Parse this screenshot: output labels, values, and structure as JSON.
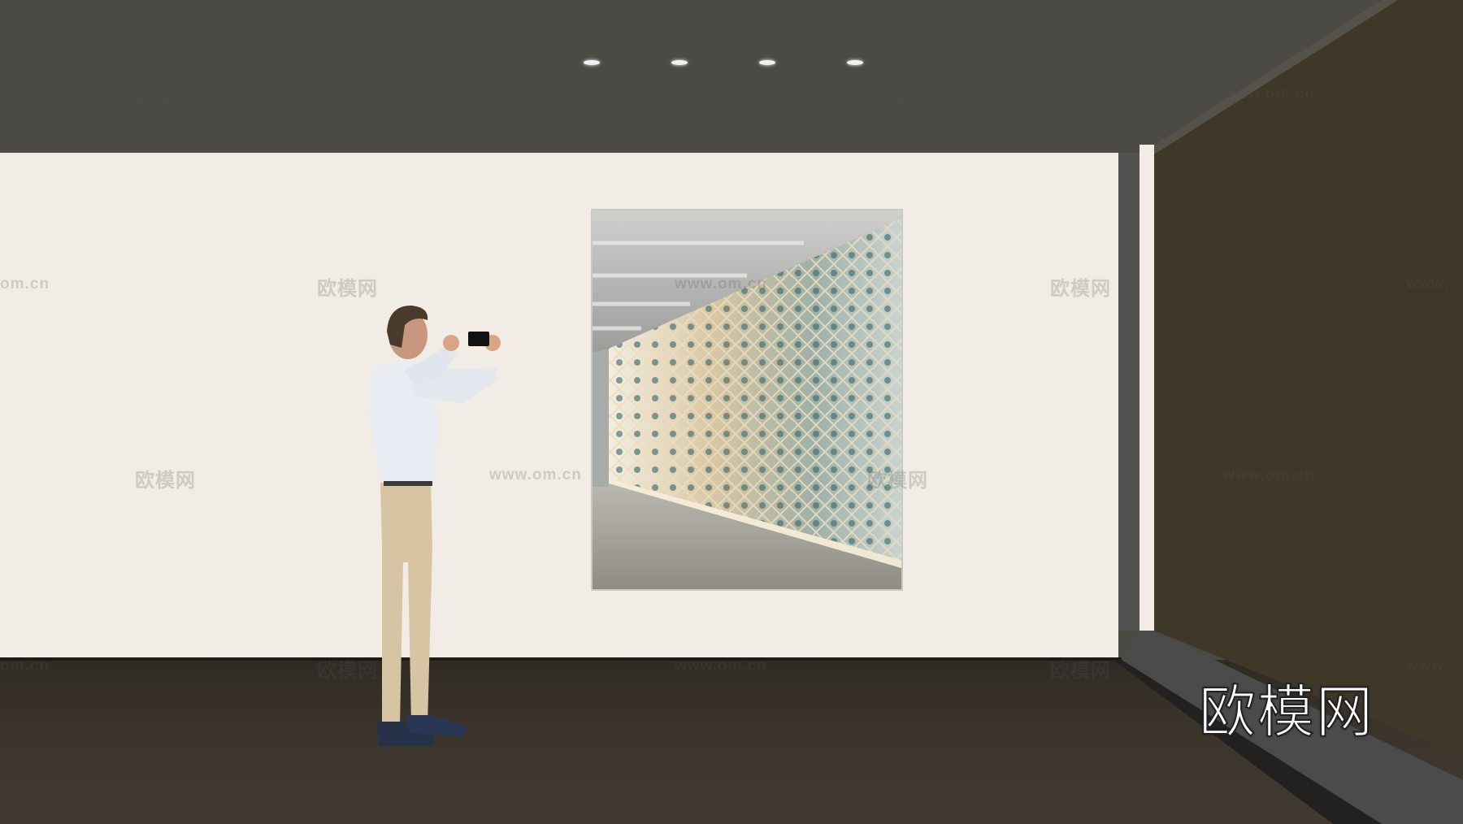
{
  "scene": {
    "logo_text": "欧模网",
    "watermark_brand": "欧模网",
    "watermark_url": "www.om.cn",
    "watermark_url_partial_left": "om.cn",
    "watermark_url_partial_right": "www.",
    "colors": {
      "ceiling": "#4b4a45",
      "back_wall": "#f1ece5",
      "side_wall": "#3e3628",
      "floor": "#3a342b"
    },
    "icons": [
      "ceiling-spotlight",
      "person-photographing",
      "framed-artwork"
    ]
  }
}
